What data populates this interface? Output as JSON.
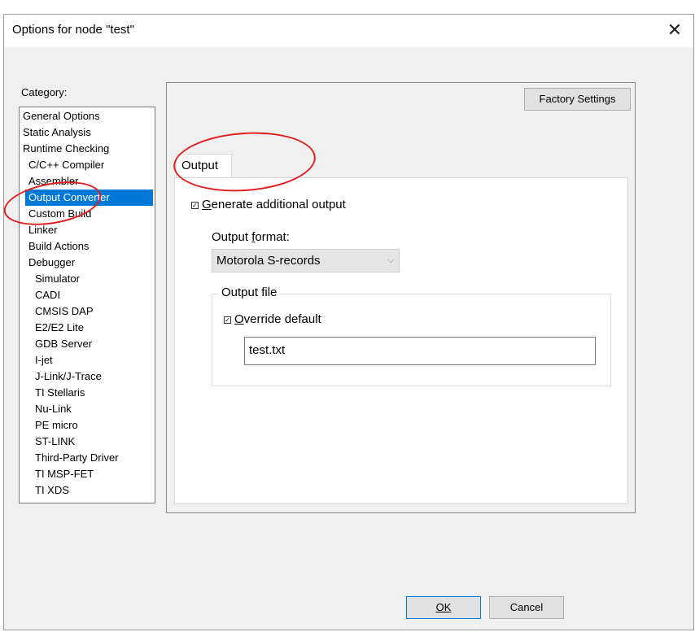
{
  "dialog": {
    "title": "Options for node \"test\"",
    "close_glyph": "✕"
  },
  "category": {
    "label": "Category:",
    "items": [
      {
        "label": "General Options"
      },
      {
        "label": "Static Analysis"
      },
      {
        "label": "Runtime Checking"
      },
      {
        "label": "C/C++ Compiler"
      },
      {
        "label": "Assembler"
      },
      {
        "label": "Output Converter",
        "selected": true
      },
      {
        "label": "Custom Build"
      },
      {
        "label": "Linker"
      },
      {
        "label": "Build Actions"
      },
      {
        "label": "Debugger"
      },
      {
        "label": "Simulator"
      },
      {
        "label": "CADI"
      },
      {
        "label": "CMSIS DAP"
      },
      {
        "label": "E2/E2 Lite"
      },
      {
        "label": "GDB Server"
      },
      {
        "label": "I-jet"
      },
      {
        "label": "J-Link/J-Trace"
      },
      {
        "label": "TI Stellaris"
      },
      {
        "label": "Nu-Link"
      },
      {
        "label": "PE micro"
      },
      {
        "label": "ST-LINK"
      },
      {
        "label": "Third-Party Driver"
      },
      {
        "label": "TI MSP-FET"
      },
      {
        "label": "TI XDS"
      }
    ]
  },
  "panel": {
    "factory_settings_label": "Factory Settings",
    "tab_label": "Output",
    "generate_output": {
      "label_first": "G",
      "label_rest": "enerate additional output",
      "checked": true
    },
    "output_format": {
      "label_pre": "Output ",
      "label_ul": "f",
      "label_post": "ormat:",
      "value": "Motorola S-records"
    },
    "output_file": {
      "group_label": "Output file",
      "override": {
        "label_first": "O",
        "label_rest": "verride default",
        "checked": true
      },
      "filename": "test.txt"
    }
  },
  "footer": {
    "ok_label": "OK",
    "cancel_label": "Cancel"
  },
  "colors": {
    "selection": "#0078d7",
    "annotation": "#e02020"
  }
}
